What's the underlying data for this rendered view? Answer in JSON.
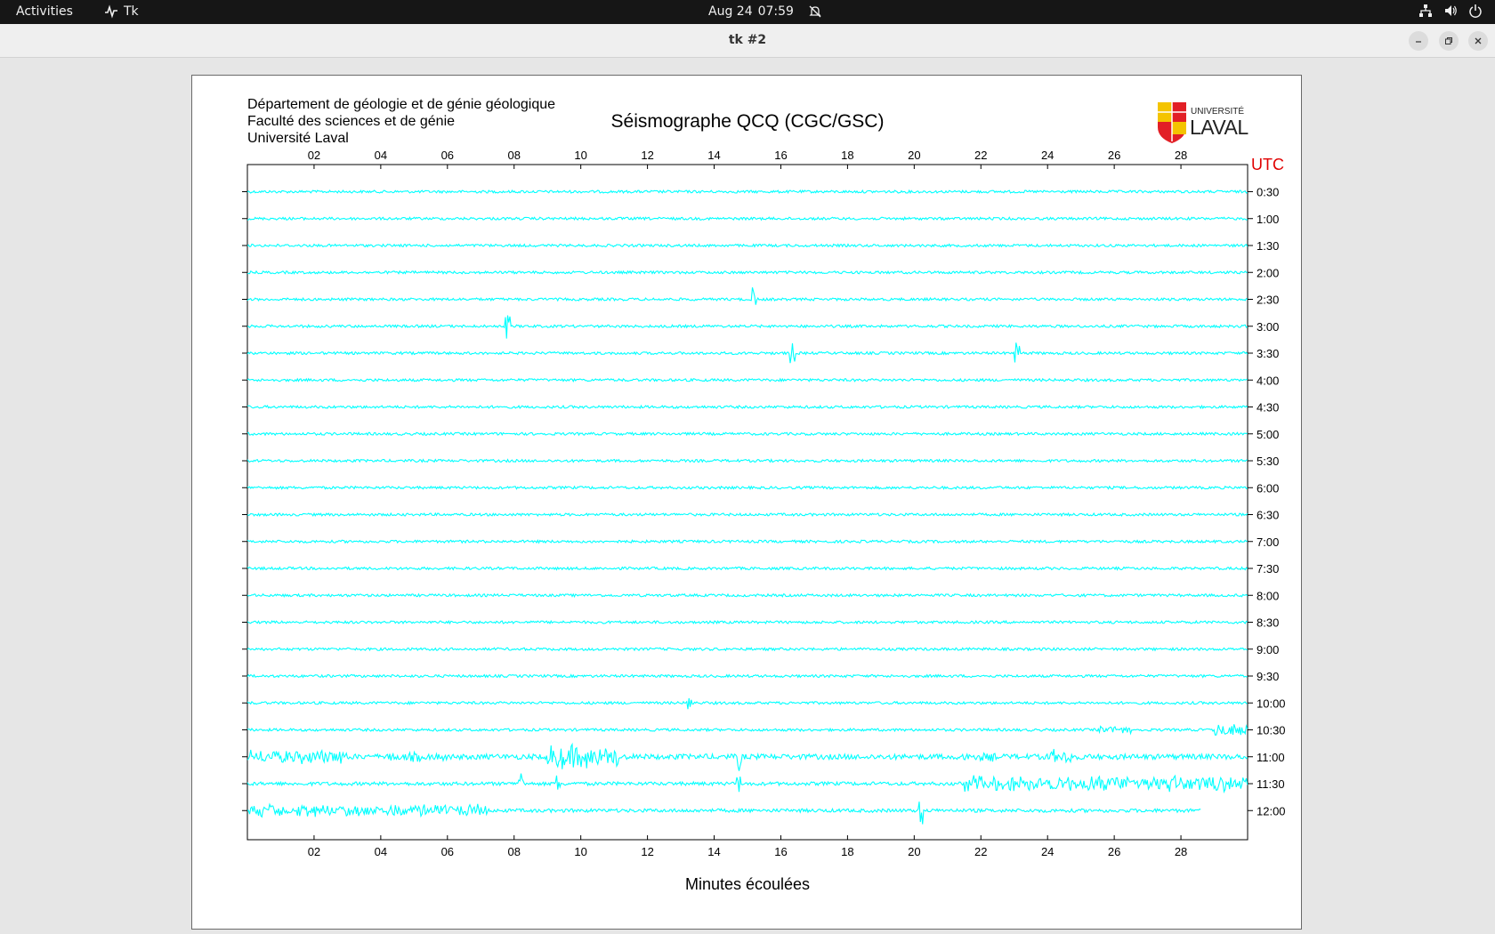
{
  "topbar": {
    "activities": "Activities",
    "app_name": "Tk",
    "app_icon": "tk-app-icon",
    "date": "Aug 24",
    "time": "07:59",
    "tray_icons": [
      "network-icon",
      "volume-icon",
      "power-icon"
    ]
  },
  "window": {
    "title": "tk #2",
    "buttons": [
      "minimize-icon",
      "restore-icon",
      "close-icon"
    ]
  },
  "plot": {
    "header_lines": [
      "Département de géologie et de génie géologique",
      "Faculté des sciences et de génie",
      "Université Laval"
    ],
    "title": "Séismographe QCQ (CGC/GSC)",
    "logo_small": "UNIVERSITÉ",
    "logo_big": "LAVAL",
    "utc_label": "UTC",
    "xlabel": "Minutes écoulées",
    "colors": {
      "trace": "#00ffff",
      "utc": "#e00000",
      "axis": "#000000"
    }
  },
  "chart_data": {
    "type": "line",
    "title": "Séismographe QCQ (CGC/GSC)",
    "xlabel": "Minutes écoulées",
    "x_ticks": [
      "02",
      "04",
      "06",
      "08",
      "10",
      "12",
      "14",
      "16",
      "18",
      "20",
      "22",
      "24",
      "26",
      "28"
    ],
    "xlim": [
      0,
      30
    ],
    "y_ticks": [
      "0:30",
      "1:00",
      "1:30",
      "2:00",
      "2:30",
      "3:00",
      "3:30",
      "4:00",
      "4:30",
      "5:00",
      "5:30",
      "6:00",
      "6:30",
      "7:00",
      "7:30",
      "8:00",
      "8:30",
      "9:00",
      "9:30",
      "10:00",
      "10:30",
      "11:00",
      "11:30",
      "12:00"
    ],
    "series": [
      {
        "label": "0:30",
        "base": 1.5,
        "spikes": []
      },
      {
        "label": "1:00",
        "base": 1.5,
        "spikes": []
      },
      {
        "label": "1:30",
        "base": 1.5,
        "spikes": []
      },
      {
        "label": "2:00",
        "base": 1.5,
        "spikes": []
      },
      {
        "label": "2:30",
        "base": 1.5,
        "spikes": [
          [
            15.2,
            14
          ]
        ]
      },
      {
        "label": "3:00",
        "base": 1.5,
        "spikes": [
          [
            7.8,
            14
          ]
        ]
      },
      {
        "label": "3:30",
        "base": 1.5,
        "spikes": [
          [
            16.35,
            12
          ],
          [
            23.1,
            12
          ]
        ]
      },
      {
        "label": "4:00",
        "base": 1.5,
        "spikes": []
      },
      {
        "label": "4:30",
        "base": 1.5,
        "spikes": []
      },
      {
        "label": "5:00",
        "base": 1.5,
        "spikes": []
      },
      {
        "label": "5:30",
        "base": 1.5,
        "spikes": []
      },
      {
        "label": "6:00",
        "base": 1.5,
        "spikes": []
      },
      {
        "label": "6:30",
        "base": 1.5,
        "spikes": []
      },
      {
        "label": "7:00",
        "base": 1.5,
        "spikes": []
      },
      {
        "label": "7:30",
        "base": 1.5,
        "spikes": []
      },
      {
        "label": "8:00",
        "base": 1.5,
        "spikes": []
      },
      {
        "label": "8:30",
        "base": 1.5,
        "spikes": []
      },
      {
        "label": "9:00",
        "base": 1.5,
        "spikes": []
      },
      {
        "label": "9:30",
        "base": 1.5,
        "spikes": []
      },
      {
        "label": "10:00",
        "base": 1.5,
        "spikes": [
          [
            13.25,
            12
          ]
        ]
      },
      {
        "label": "10:30",
        "base": 1.5,
        "bursts": [
          [
            25.5,
            26.5,
            5
          ],
          [
            29.0,
            30.0,
            10
          ]
        ],
        "spikes": []
      },
      {
        "label": "11:00",
        "base": 3,
        "bursts": [
          [
            0,
            3,
            9
          ],
          [
            4,
            6,
            6
          ],
          [
            9,
            11.2,
            16
          ],
          [
            21.5,
            22.5,
            6
          ],
          [
            24,
            24.8,
            9
          ]
        ],
        "spikes": [
          [
            14.75,
            16
          ]
        ]
      },
      {
        "label": "11:30",
        "base": 2,
        "bursts": [
          [
            21.5,
            30,
            10
          ]
        ],
        "spikes": [
          [
            8.2,
            14
          ],
          [
            9.3,
            10
          ],
          [
            14.7,
            10
          ]
        ]
      },
      {
        "label": "12:00",
        "base": 2,
        "end": 28.6,
        "bursts": [
          [
            0,
            7.2,
            8
          ]
        ],
        "spikes": [
          [
            20.2,
            16
          ]
        ]
      }
    ]
  }
}
